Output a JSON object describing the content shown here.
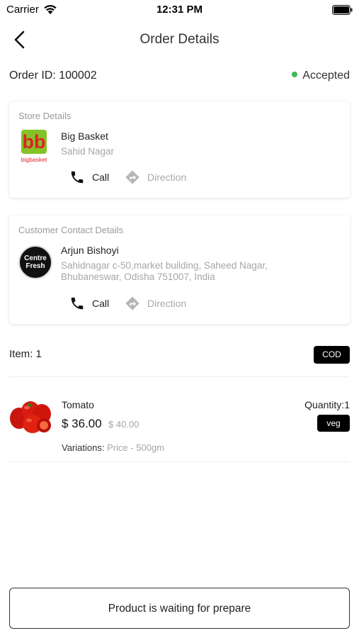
{
  "status_bar": {
    "carrier": "Carrier",
    "time": "12:31 PM"
  },
  "nav": {
    "title": "Order Details"
  },
  "order": {
    "id_label": "Order ID: 100002",
    "status": "Accepted",
    "status_color": "#3cba54"
  },
  "store": {
    "section_title": "Store Details",
    "name": "Big Basket",
    "location": "Sahid Nagar",
    "logo_text": "bigbasket",
    "call_label": "Call",
    "direction_label": "Direction"
  },
  "customer": {
    "section_title": "Customer Contact Details",
    "name": "Arjun Bishoyi",
    "address_line1": "Sahidnagar c-50,market building, Saheed Nagar,",
    "address_line2": "Bhubaneswar, Odisha 751007, India",
    "logo_line1": "Centre",
    "logo_line2": "Fresh",
    "call_label": "Call",
    "direction_label": "Direction"
  },
  "items": {
    "count_label": "Item: 1",
    "payment_badge": "COD"
  },
  "product": {
    "name": "Tomato",
    "price": "$ 36.00",
    "old_price": "$ 40.00",
    "quantity": "Quantity:1",
    "tag": "veg",
    "variations_label": "Variations:",
    "variations_value": "Price - 500gm"
  },
  "footer": {
    "button_label": "Product is waiting for prepare"
  }
}
